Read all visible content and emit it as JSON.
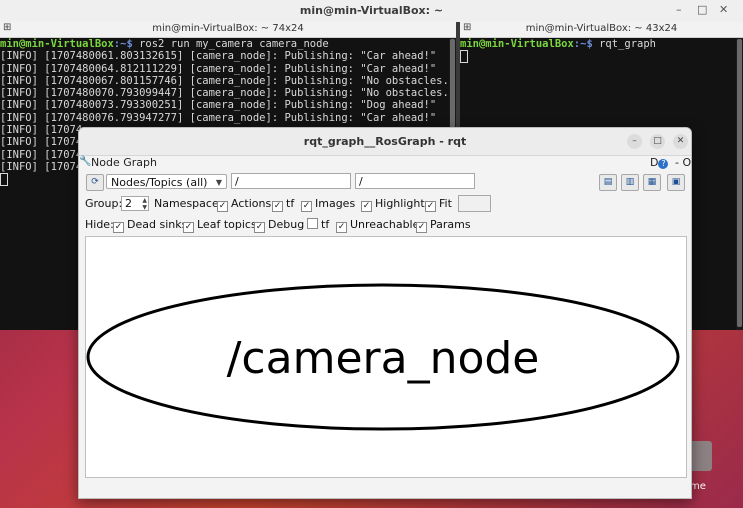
{
  "top_window": {
    "title": "min@min-VirtualBox: ~",
    "minimize": "–",
    "maximize": "□",
    "close": "✕"
  },
  "left_terminal": {
    "title": "min@min-VirtualBox: ~ 74x24",
    "prompt_user": "min@min-VirtualBox",
    "prompt_path": ":~$",
    "command": " ros2 run my_camera camera_node",
    "lines": [
      "[INFO] [1707480061.803132615] [camera_node]: Publishing: \"Car ahead!\"",
      "[INFO] [1707480064.812111229] [camera_node]: Publishing: \"Car ahead!\"",
      "[INFO] [1707480067.801157746] [camera_node]: Publishing: \"No obstacles.\"",
      "[INFO] [1707480070.793099447] [camera_node]: Publishing: \"No obstacles.\"",
      "[INFO] [1707480073.793300251] [camera_node]: Publishing: \"Dog ahead!\"",
      "[INFO] [1707480076.793947277] [camera_node]: Publishing: \"Car ahead!\"",
      "[INFO] [17074",
      "[INFO] [17074",
      "[INFO] [17074",
      "[INFO] [17074"
    ]
  },
  "right_terminal": {
    "title": "min@min-VirtualBox: ~ 43x24",
    "prompt_user": "min@min-VirtualBox",
    "prompt_path": ":~$",
    "command": " rqt_graph"
  },
  "rqt": {
    "title": "rqt_graph__RosGraph - rqt",
    "plugin_label": "Node Graph",
    "plugin_right": "D",
    "plugin_close": "- O",
    "filter_combo": "Nodes/Topics (all)",
    "ns_filter": "/",
    "topic_filter": "/",
    "group_label": "Group:",
    "group_value": "2",
    "namespaces": "Namespaces",
    "actions": "Actions",
    "tf": "tf",
    "images": "Images",
    "highlight": "Highlight",
    "fit": "Fit",
    "hide_label": "Hide:",
    "dead_sinks": "Dead sinks",
    "leaf_topics": "Leaf topics",
    "debug": "Debug",
    "tf_hide": "tf",
    "unreachable": "Unreachable",
    "params": "Params",
    "node_name": "/camera_node",
    "check": "✓"
  },
  "desktop": {
    "icon_label": "me"
  }
}
